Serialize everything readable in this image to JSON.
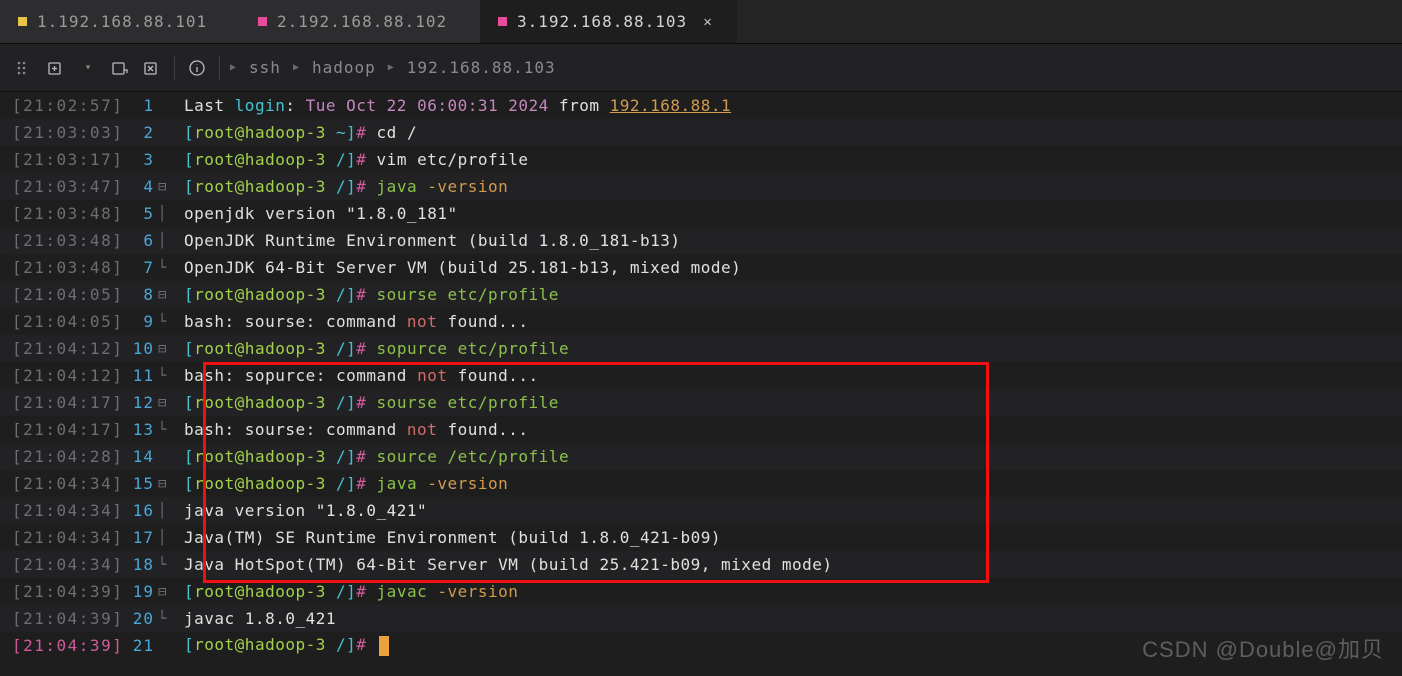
{
  "tabs": [
    {
      "dot": "#e8c547",
      "label": "1.192.168.88.101",
      "active": false,
      "close": false
    },
    {
      "dot": "#e84a9c",
      "label": "2.192.168.88.102",
      "active": false,
      "close": false
    },
    {
      "dot": "#e84a9c",
      "label": "3.192.168.88.103",
      "active": true,
      "close": true
    }
  ],
  "breadcrumb": {
    "a": "ssh",
    "b": "hadoop",
    "c": "192.168.88.103"
  },
  "lastLoginPrefix": "Last ",
  "lastLoginKw": "login",
  "lastLoginColon": ": ",
  "lastLoginDate": "Tue Oct 22 06:00:31 2024",
  "lastLoginFrom": " from ",
  "lastLoginIp": "192.168.88.1",
  "prompt": {
    "lb": "[",
    "rb": "]",
    "root": "root@hadoop-3",
    "home": " ~",
    "slash": " /",
    "hash": "# "
  },
  "cmds": {
    "cd": "cd /",
    "vim": "vim etc/profile",
    "java": "java ",
    "ver": "-version",
    "sourse": "sourse etc/profile",
    "sopurce": "sopurce etc/profile",
    "source": "source /etc/profile",
    "javac": "javac ",
    "javacver": "-version"
  },
  "out": {
    "ojver": "openjdk version \"1.8.0_181\"",
    "ojre": "OpenJDK Runtime Environment (build 1.8.0_181-b13)",
    "ojvm": "OpenJDK 64-Bit Server VM (build 25.181-b13, mixed mode)",
    "nf_pre": "bash: ",
    "nf_cmd1": "sourse",
    "nf_cmd2": "sopurce",
    "nf_mid": ": command ",
    "nf_not": "not",
    "nf_end": " found...",
    "jver": "java version \"1.8.0_421\"",
    "jre": "Java(TM) SE Runtime Environment (build 1.8.0_421-b09)",
    "jvm": "Java HotSpot(TM) 64-Bit Server VM (build 25.421-b09, mixed mode)",
    "javac": "javac 1.8.0_421"
  },
  "timestamps": [
    "21:02:57",
    "21:03:03",
    "21:03:17",
    "21:03:47",
    "21:03:48",
    "21:03:48",
    "21:03:48",
    "21:04:05",
    "21:04:05",
    "21:04:12",
    "21:04:12",
    "21:04:17",
    "21:04:17",
    "21:04:28",
    "21:04:34",
    "21:04:34",
    "21:04:34",
    "21:04:34",
    "21:04:39",
    "21:04:39",
    "21:04:39"
  ],
  "watermark": "CSDN @Double@加贝"
}
